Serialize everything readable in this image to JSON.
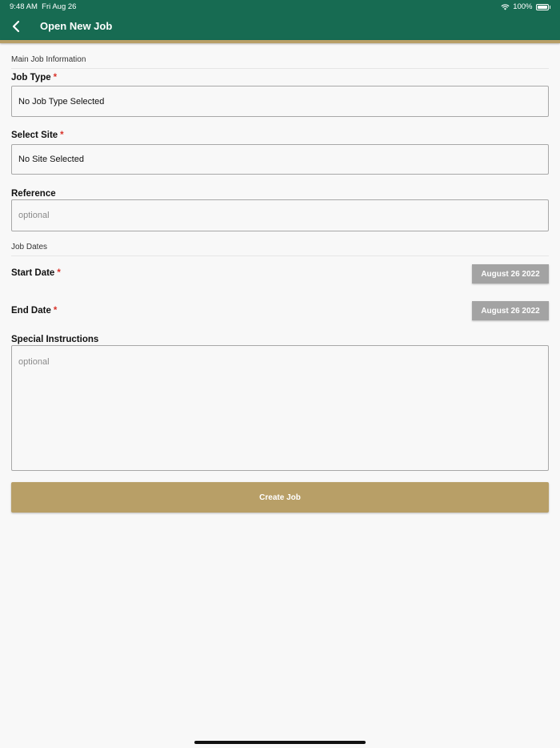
{
  "status_bar": {
    "time": "9:48 AM",
    "date": "Fri Aug 26",
    "battery": "100%"
  },
  "nav": {
    "title": "Open New Job"
  },
  "main_section": {
    "header": "Main Job Information"
  },
  "job_type": {
    "label": "Job Type",
    "required": "*",
    "value": "No Job Type Selected"
  },
  "site": {
    "label": "Select Site",
    "required": "*",
    "value": "No Site Selected"
  },
  "reference": {
    "label": "Reference",
    "placeholder": "optional"
  },
  "dates_section": {
    "header": "Job Dates"
  },
  "start_date": {
    "label": "Start Date",
    "required": "*",
    "value": "August 26 2022"
  },
  "end_date": {
    "label": "End Date",
    "required": "*",
    "value": "August 26 2022"
  },
  "special_instructions": {
    "label": "Special Instructions",
    "placeholder": "optional"
  },
  "create_button": {
    "label": "Create Job"
  },
  "colors": {
    "header_green": "#176b52",
    "gold_accent": "#b89f67",
    "required_red": "#d9342b",
    "date_button_gray": "#a3a3a3"
  }
}
